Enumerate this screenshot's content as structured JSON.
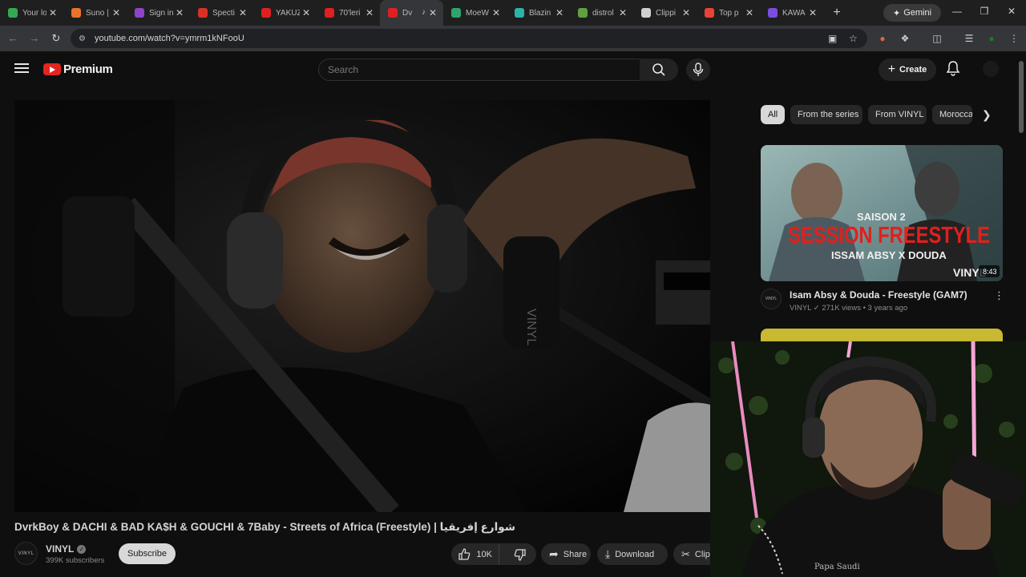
{
  "browser": {
    "tabs": [
      {
        "label": "Your lo",
        "color": "#34a853"
      },
      {
        "label": "Suno |",
        "color": "#e8742a"
      },
      {
        "label": "Sign in",
        "color": "#8e44c9"
      },
      {
        "label": "Specti",
        "color": "#d93025"
      },
      {
        "label": "YAKUZ",
        "color": "#e02020"
      },
      {
        "label": "70'leri",
        "color": "#e02020"
      },
      {
        "label": "Dv",
        "color": "#e02020",
        "active": true
      },
      {
        "label": "MoeW",
        "color": "#2ea56a"
      },
      {
        "label": "Blazin",
        "color": "#2bb3a8"
      },
      {
        "label": "distrol",
        "color": "#5fa040"
      },
      {
        "label": "Clippi",
        "color": "#d0d0d0"
      },
      {
        "label": "Top p",
        "color": "#ea4335"
      },
      {
        "label": "KAWA",
        "color": "#7b4de0"
      }
    ],
    "new_tab": "+",
    "gemini_label": "Gemini",
    "url": "youtube.com/watch?v=ymrm1kNFooU"
  },
  "youtube": {
    "logo_text": "Premium",
    "search_placeholder": "Search",
    "create_label": "Create",
    "video": {
      "title": "DvrkBoy & DACHI & BAD KA$H & GOUCHI & 7Baby - Streets of Africa (Freestyle) | شوارع إفريقيا",
      "channel": "VINYL",
      "subscribers": "399K subscribers",
      "subscribe_label": "Subscribe",
      "likes": "10K",
      "share_label": "Share",
      "download_label": "Download",
      "clip_label": "Clip",
      "player_watermark": "VINYL"
    },
    "chips": [
      "All",
      "From the series",
      "From VINYL",
      "Moroccan"
    ],
    "recommendation": {
      "thumb_season": "SAISON 2",
      "thumb_headline": "SESSION FREESTYLE",
      "thumb_names": "ISSAM ABSY X DOUDA",
      "thumb_brand": "VINYL",
      "duration": "8:43",
      "title": "Isam Absy & Douda - Freestyle (GAM7)",
      "channel": "VINYL",
      "meta": "271K views • 3 years ago"
    },
    "webcam_hoodie_text": "Papa Saudi"
  }
}
